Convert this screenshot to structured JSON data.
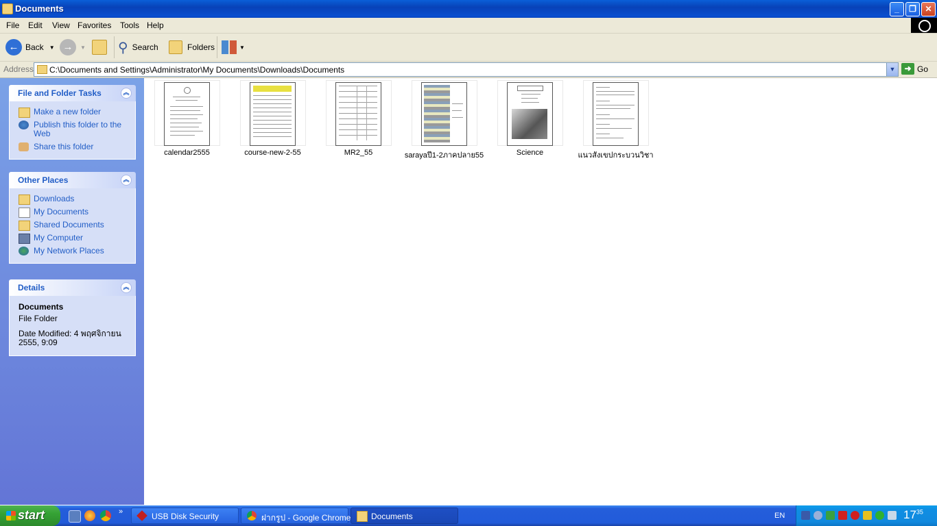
{
  "window": {
    "title": "Documents"
  },
  "menu": [
    "File",
    "Edit",
    "View",
    "Favorites",
    "Tools",
    "Help"
  ],
  "toolbar": {
    "back": "Back",
    "search": "Search",
    "folders": "Folders"
  },
  "address": {
    "label": "Address",
    "path": "C:\\Documents and Settings\\Administrator\\My Documents\\Downloads\\Documents",
    "go": "Go"
  },
  "tasks_panel": {
    "title": "File and Folder Tasks",
    "items": [
      "Make a new folder",
      "Publish this folder to the Web",
      "Share this folder"
    ]
  },
  "places_panel": {
    "title": "Other Places",
    "items": [
      "Downloads",
      "My Documents",
      "Shared Documents",
      "My Computer",
      "My Network Places"
    ]
  },
  "details_panel": {
    "title": "Details",
    "name": "Documents",
    "type": "File Folder",
    "modified": "Date Modified: 4 พฤศจิกายน 2555, 9:09"
  },
  "files": [
    {
      "name": "calendar2555"
    },
    {
      "name": "course-new-2-55"
    },
    {
      "name": "MR2_55"
    },
    {
      "name": "sarayaปี1-2ภาคปลาย55"
    },
    {
      "name": "Science"
    },
    {
      "name": "แนวสังเขปกระบวนวิชา"
    }
  ],
  "taskbar": {
    "start": "start",
    "tasks": [
      "USB Disk Security",
      "ฝากรูป - Google Chrome",
      "Documents"
    ],
    "lang": "EN",
    "clock_hour": "17",
    "clock_min": "35"
  },
  "colors": {
    "xp_blue": "#0a4fcf",
    "panel_link": "#215dc6",
    "start_green": "#35a235"
  }
}
